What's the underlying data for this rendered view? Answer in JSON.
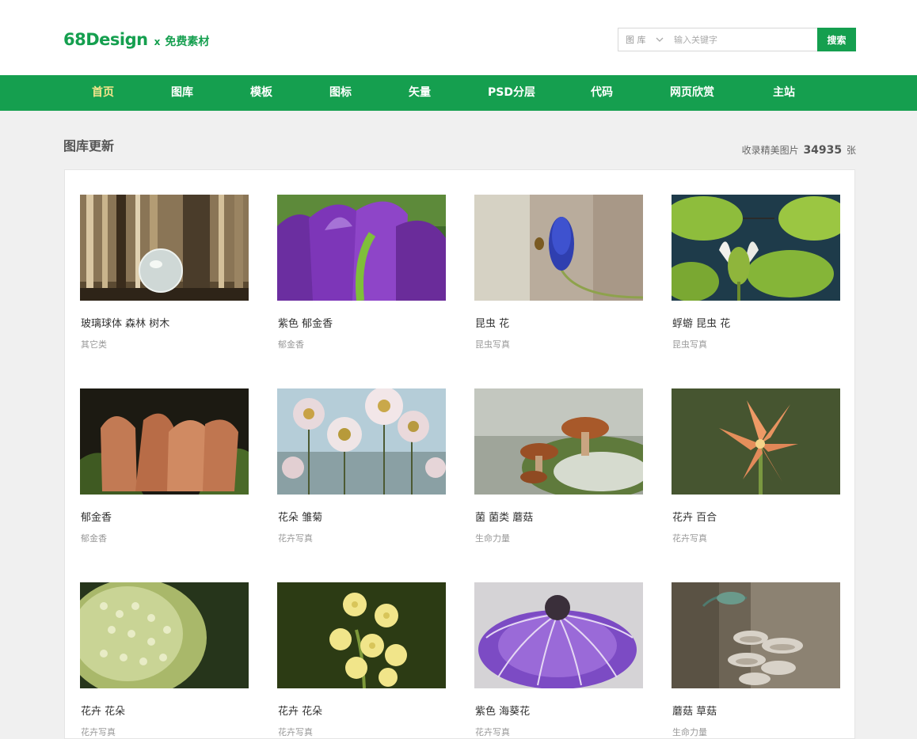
{
  "header": {
    "logo_main": "68Design",
    "logo_x": "x",
    "logo_sub": "免费素材",
    "search": {
      "category": "图 库",
      "placeholder": "输入关键字",
      "button": "搜索"
    }
  },
  "nav": [
    {
      "label": "首页",
      "active": true
    },
    {
      "label": "图库"
    },
    {
      "label": "模板"
    },
    {
      "label": "图标"
    },
    {
      "label": "矢量"
    },
    {
      "label": "PSD分层"
    },
    {
      "label": "代码"
    },
    {
      "label": "网页欣赏"
    },
    {
      "label": "主站"
    }
  ],
  "main": {
    "section_title": "图库更新",
    "count_prefix": "收录精美图片",
    "count_value": "34935",
    "count_suffix": "张"
  },
  "cards": [
    {
      "title": "玻璃球体 森林 树木",
      "category": "其它类"
    },
    {
      "title": "紫色 郁金香",
      "category": "郁金香"
    },
    {
      "title": "昆虫 花",
      "category": "昆虫写真"
    },
    {
      "title": "蜉蝣 昆虫 花",
      "category": "昆虫写真"
    },
    {
      "title": "郁金香",
      "category": "郁金香"
    },
    {
      "title": "花朵 雏菊",
      "category": "花卉写真"
    },
    {
      "title": "菌 菌类 蘑菇",
      "category": "生命力量"
    },
    {
      "title": "花卉 百合",
      "category": "花卉写真"
    },
    {
      "title": "花卉 花朵",
      "category": "花卉写真"
    },
    {
      "title": "花卉 花朵",
      "category": "花卉写真"
    },
    {
      "title": "紫色 海葵花",
      "category": "花卉写真"
    },
    {
      "title": "蘑菇 草菇",
      "category": "生命力量"
    }
  ],
  "colors": {
    "brand": "#159f4f",
    "nav_active": "#f5e58c"
  }
}
